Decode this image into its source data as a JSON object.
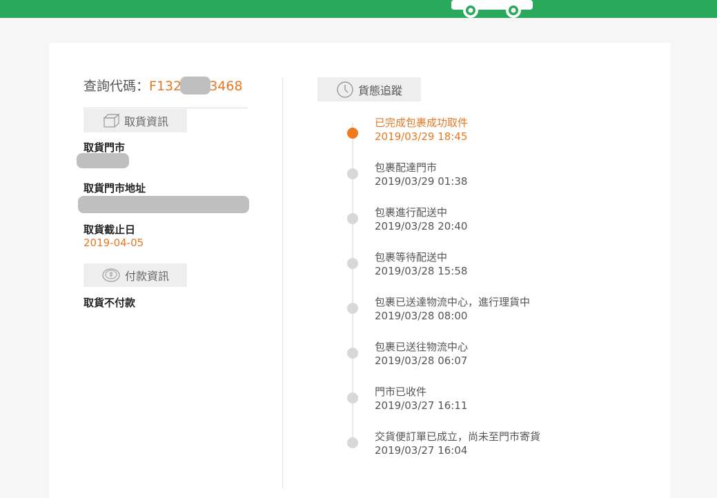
{
  "query": {
    "label": "查詢代碼：",
    "code_prefix": "F132",
    "code_suffix": "3468"
  },
  "pickup_section": {
    "tab_label": "取貨資訊",
    "icon": "box-icon",
    "store_label": "取貨門市",
    "address_label": "取貨門市地址",
    "deadline_label": "取貨截止日",
    "deadline_value": "2019-04-05"
  },
  "payment_section": {
    "tab_label": "付款資訊",
    "icon": "coin-icon",
    "payment_value": "取貨不付款"
  },
  "tracking": {
    "tab_label": "貨態追蹤",
    "icon": "clock-icon",
    "events": [
      {
        "status": "已完成包裹成功取件",
        "time": "2019/03/29 18:45",
        "active": true
      },
      {
        "status": "包裹配達門市",
        "time": "2019/03/29 01:38",
        "active": false
      },
      {
        "status": "包裹進行配送中",
        "time": "2019/03/28 20:40",
        "active": false
      },
      {
        "status": "包裹等待配送中",
        "time": "2019/03/28 15:58",
        "active": false
      },
      {
        "status": "包裹已送達物流中心，進行理貨中",
        "time": "2019/03/28 08:00",
        "active": false
      },
      {
        "status": "包裹已送往物流中心",
        "time": "2019/03/28 06:07",
        "active": false
      },
      {
        "status": "門市已收件",
        "time": "2019/03/27 16:11",
        "active": false
      },
      {
        "status": "交貨便訂單已成立，尚未至門市寄貨",
        "time": "2019/03/27 16:04",
        "active": false
      }
    ]
  },
  "colors": {
    "brand_green": "#2aa95a",
    "accent_orange": "#e87722"
  }
}
